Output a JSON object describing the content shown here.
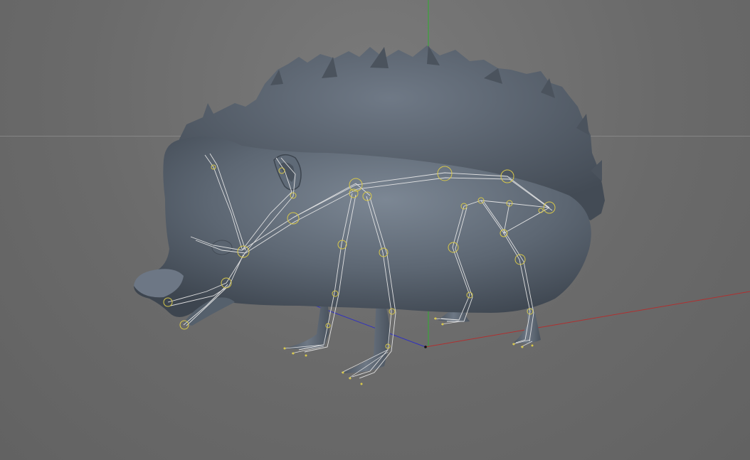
{
  "viewport": {
    "name": "3D Viewport",
    "background_color": "#6b6b6b",
    "horizon_line": "visible"
  },
  "scene": {
    "model": "hedgehog-mesh",
    "mesh_color": "#5c6672",
    "rig": "joint-skeleton",
    "joint_color": "#d8c84a",
    "bone_color": "#e8e8e8",
    "axes": {
      "x_color": "#b03030",
      "y_color": "#2fae2f",
      "z_color": "#3030c0"
    }
  }
}
